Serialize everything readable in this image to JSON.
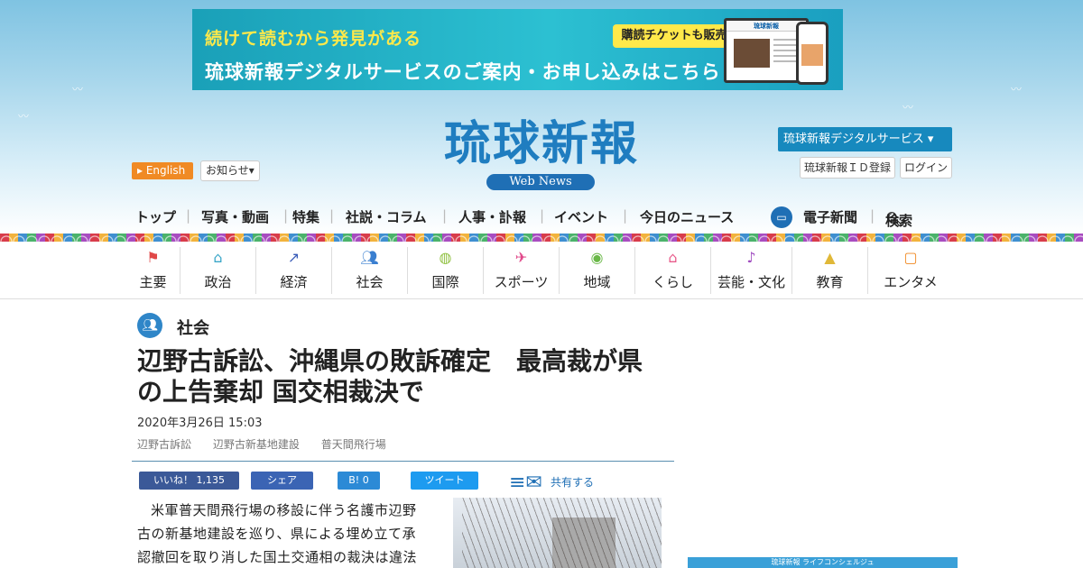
{
  "banner": {
    "line1": "続けて読むから発見がある",
    "tag": "購読チケットも販売中！",
    "line2": "琉球新報デジタルサービスのご案内・お申し込みはこちら",
    "device_title": "琉球新報"
  },
  "logo": {
    "title": "琉球新報",
    "sub": "Web News"
  },
  "header": {
    "english": "English",
    "notice": "お知らせ",
    "digital_service": "琉球新報デジタルサービス",
    "id_register": "琉球新報ＩＤ登録",
    "login": "ログイン"
  },
  "main_nav": {
    "items": [
      "トップ",
      "写真・動画",
      "特集",
      "社説・コラム",
      "人事・訃報",
      "イベント",
      "今日のニュース",
      "電子新聞",
      "検索"
    ]
  },
  "categories": [
    {
      "label": "主要",
      "icon": "flag-icon",
      "color": "#e04848"
    },
    {
      "label": "政治",
      "icon": "building-icon",
      "color": "#3aa6c8"
    },
    {
      "label": "経済",
      "icon": "chart-icon",
      "color": "#3a5cb8"
    },
    {
      "label": "社会",
      "icon": "people-icon",
      "color": "#3a7fd0"
    },
    {
      "label": "国際",
      "icon": "globe-icon",
      "color": "#8fc040"
    },
    {
      "label": "スポーツ",
      "icon": "runner-icon",
      "color": "#e0488a"
    },
    {
      "label": "地域",
      "icon": "pin-icon",
      "color": "#6ab848"
    },
    {
      "label": "くらし",
      "icon": "house-icon",
      "color": "#e85a8a"
    },
    {
      "label": "芸能・文化",
      "icon": "music-icon",
      "color": "#a04cc0"
    },
    {
      "label": "教育",
      "icon": "graduation-icon",
      "color": "#e0b838"
    },
    {
      "label": "エンタメ",
      "icon": "tv-icon",
      "color": "#f08a24"
    }
  ],
  "article": {
    "section": "社会",
    "headline": "辺野古訴訟、沖縄県の敗訴確定　最高裁が県の上告棄却 国交相裁決で",
    "date": "2020年3月26日 15:03",
    "tags": [
      "辺野古訴訟",
      "辺野古新基地建設",
      "普天間飛行場"
    ],
    "body": "米軍普天間飛行場の移設に伴う名護市辺野古の新基地建設を巡り、県による埋め立て承認撤回を取り消した国土交通相の裁決は違法"
  },
  "share": {
    "like": "いいね！ 1,135",
    "facebook": "シェア",
    "hatena": "B! 0",
    "tweet": "ツイート",
    "share_all": "共有する"
  },
  "side": {
    "banner": "琉球新報 ライフコンシェルジュ"
  }
}
